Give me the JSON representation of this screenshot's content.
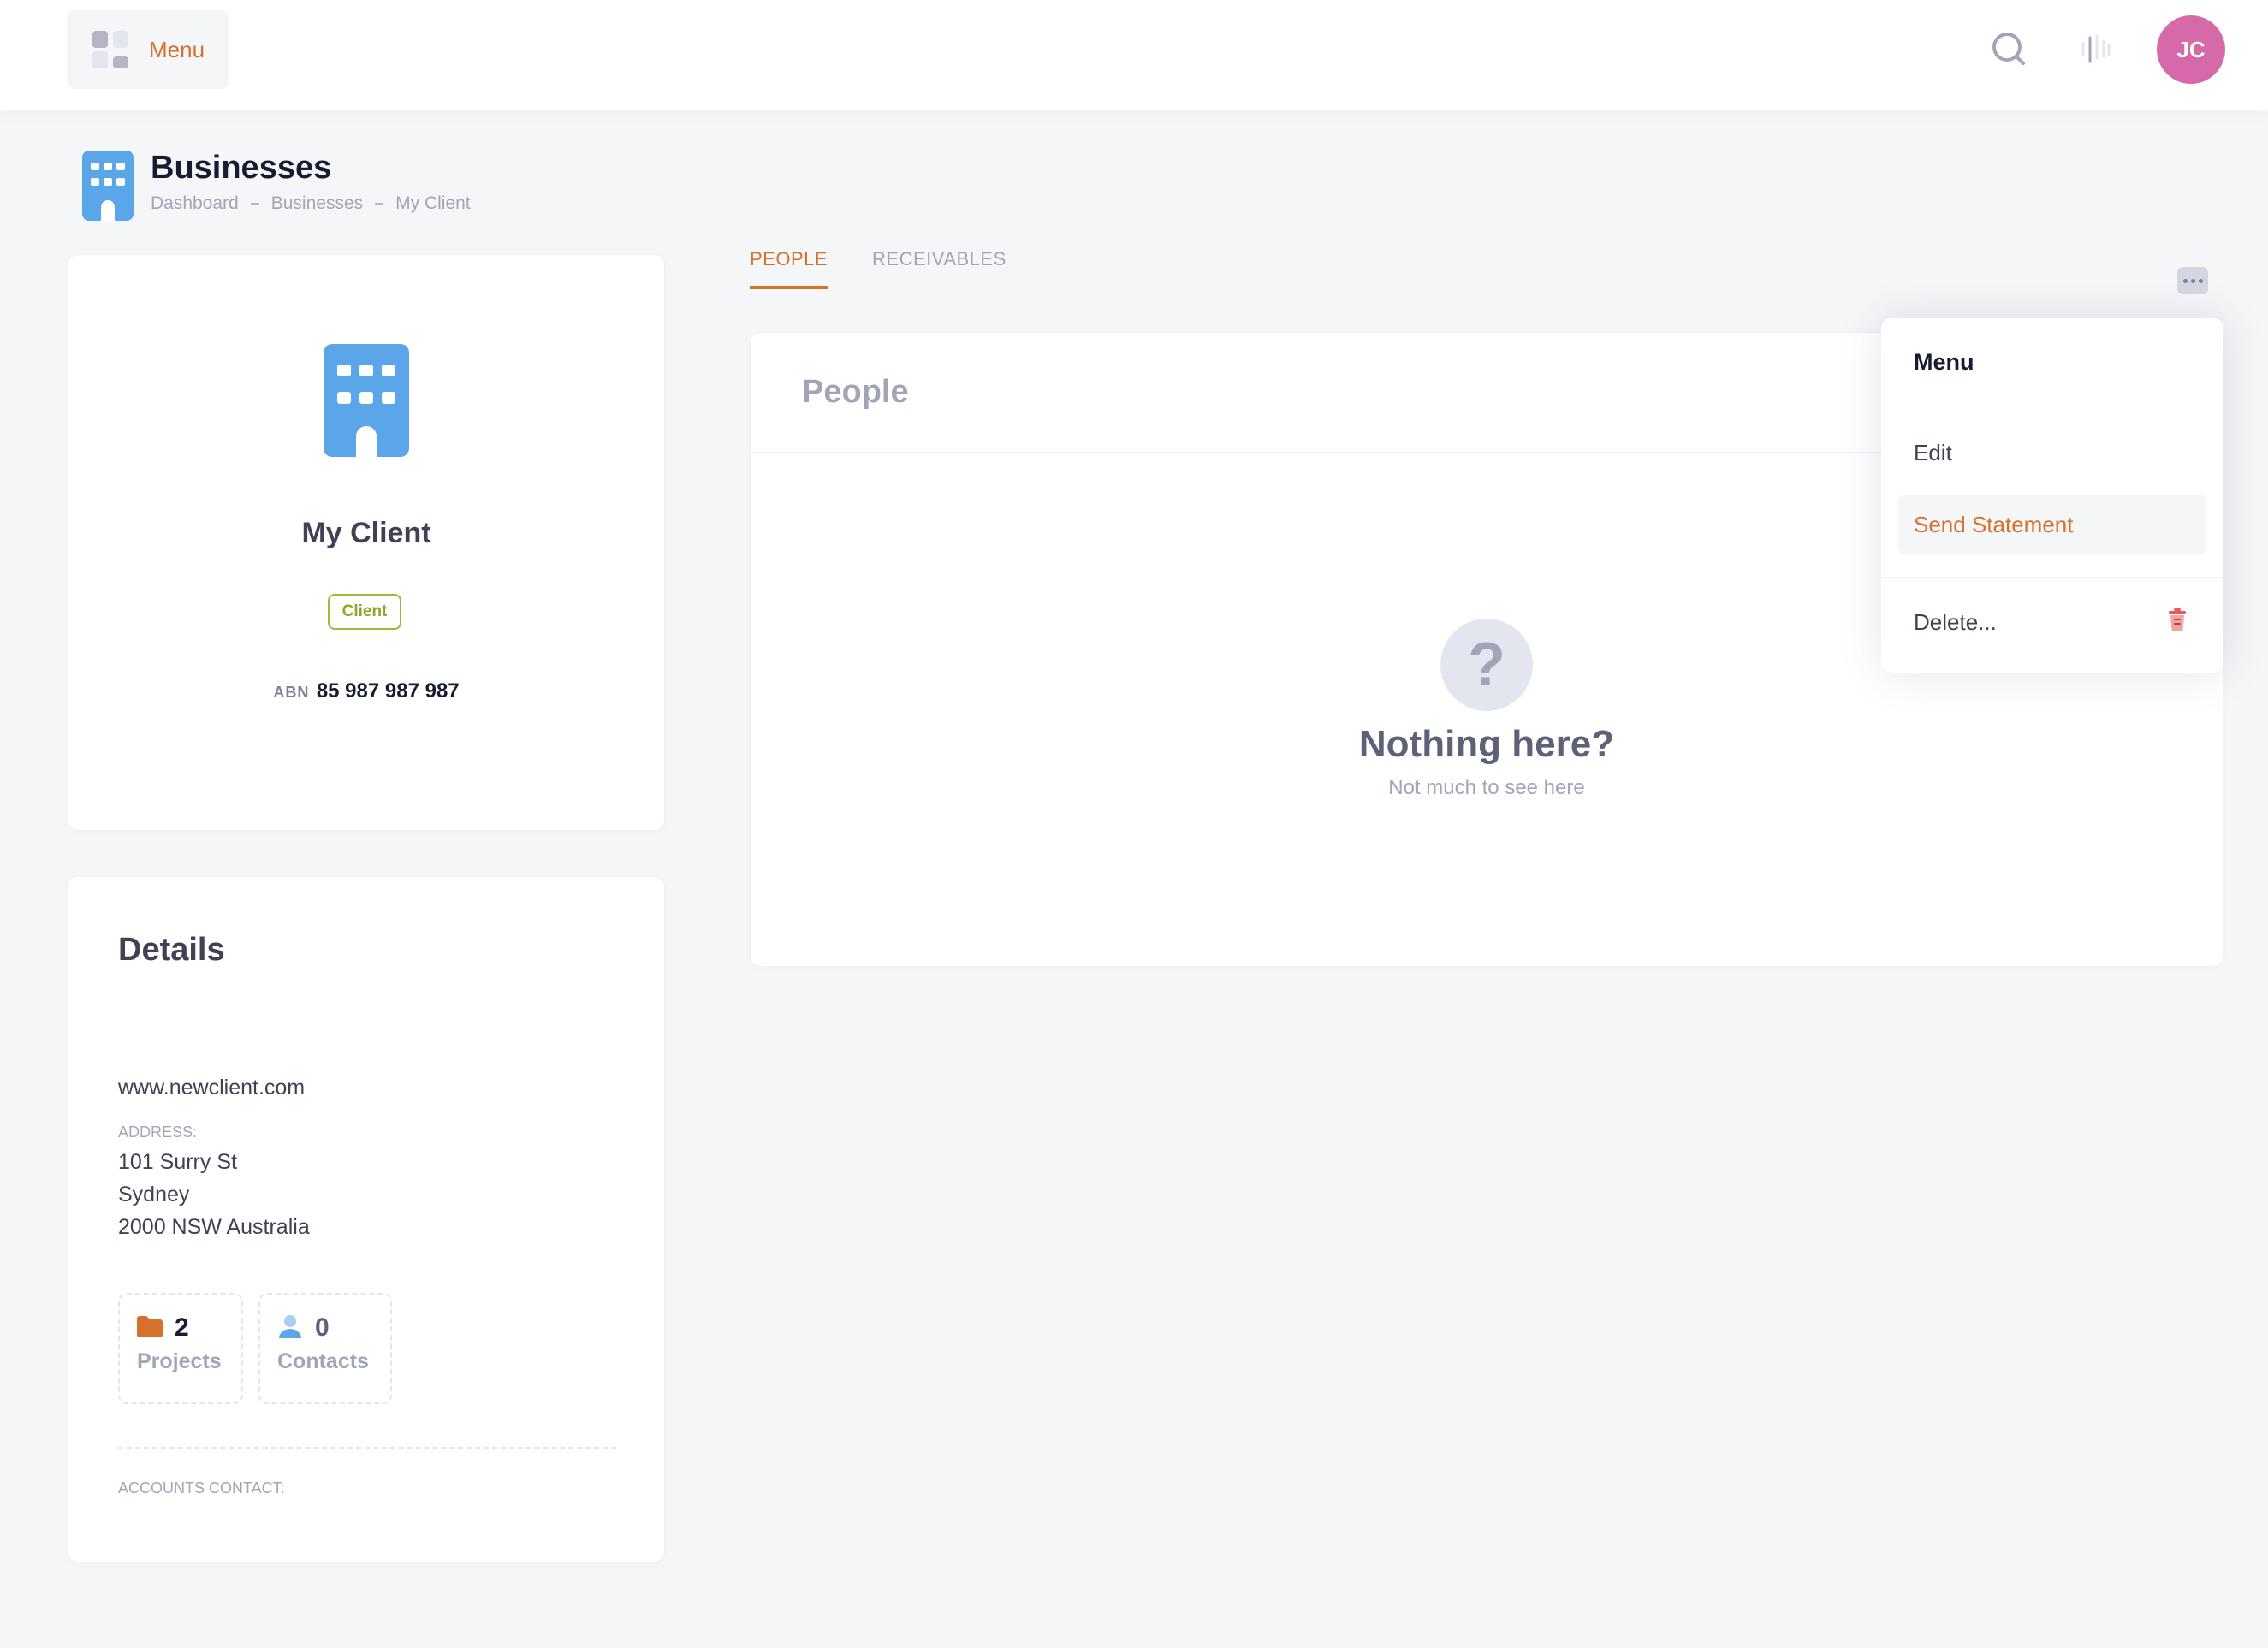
{
  "topbar": {
    "menu_label": "Menu",
    "avatar_initials": "JC",
    "accent_color": "#d6702d",
    "avatar_color": "#d66aa8"
  },
  "page": {
    "title": "Businesses",
    "breadcrumb": [
      "Dashboard",
      "Businesses",
      "My Client"
    ]
  },
  "client": {
    "name": "My Client",
    "badge": "Client",
    "abn_label": "ABN",
    "abn_value": "85 987 987 987"
  },
  "details": {
    "title": "Details",
    "website": "www.newclient.com",
    "address_label": "ADDRESS:",
    "address_lines": [
      "101 Surry St",
      "Sydney",
      "2000 NSW Australia"
    ],
    "projects_count": "2",
    "projects_label": "Projects",
    "contacts_count": "0",
    "contacts_label": "Contacts",
    "accounts_contact_label": "ACCOUNTS CONTACT:"
  },
  "tabs": [
    {
      "label": "PEOPLE",
      "active": true
    },
    {
      "label": "RECEIVABLES",
      "active": false
    }
  ],
  "people": {
    "title": "People",
    "empty_glyph": "?",
    "empty_title": "Nothing here?",
    "empty_subtitle": "Not much to see here"
  },
  "dropdown": {
    "title": "Menu",
    "items": [
      "Edit",
      "Send Statement",
      "Delete..."
    ]
  },
  "icons": [
    "grid-icon",
    "search-icon",
    "bars-icon",
    "building-icon",
    "folder-icon",
    "user-icon",
    "dots-icon",
    "trash-icon"
  ]
}
